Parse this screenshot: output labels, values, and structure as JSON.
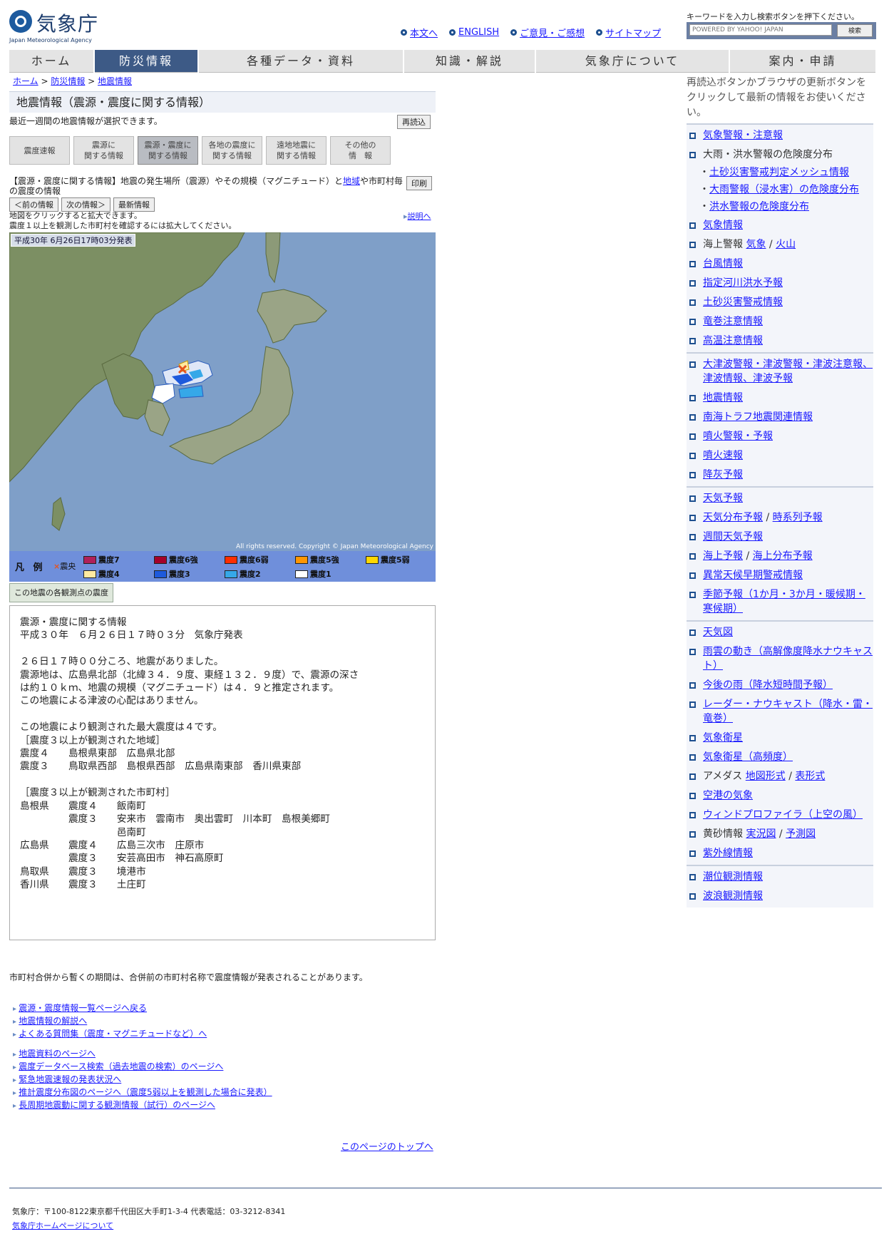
{
  "header": {
    "logo_text": "気象庁",
    "logo_sub": "Japan Meteorological Agency",
    "links": [
      "本文へ",
      "ENGLISH",
      "ご意見・ご感想",
      "サイトマップ"
    ],
    "search_hint": "キーワードを入力し検索ボタンを押下ください。",
    "search_placeholder": "POWERED BY YAHOO! JAPAN",
    "search_button": "検索"
  },
  "nav": [
    "ホーム",
    "防災情報",
    "各種データ・資料",
    "知識・解説",
    "気象庁について",
    "案内・申請"
  ],
  "breadcrumb": [
    "ホーム",
    "防災情報",
    "地震情報"
  ],
  "title": "地震情報（震源・震度に関する情報）",
  "subtitle": "最近一週間の地震情報が選択できます。",
  "reload": "再読込",
  "tabs": [
    [
      "震度速報",
      ""
    ],
    [
      "震源に",
      "関する情報"
    ],
    [
      "震源・震度に",
      "関する情報"
    ],
    [
      "各地の震度に",
      "関する情報"
    ],
    [
      "遠地地震に",
      "関する情報"
    ],
    [
      "その他の",
      "情　報"
    ]
  ],
  "desc_prefix": "【震源・震度に関する情報】地震の発生場所（震源）やその規模（マグニチュード）と",
  "desc_link": "地域",
  "desc_suffix": "や市町村毎の震度の情報",
  "print": "印刷",
  "nav_buttons": [
    "＜前の情報",
    "次の情報＞",
    "最新情報"
  ],
  "hint1": "地図をクリックすると拡大できます。",
  "hint2": "震度１以上を観測した市町村を確認するには拡大してください。",
  "explain": "説明へ",
  "map": {
    "published": "平成30年 6月26日17時03分発表",
    "copyright": "All rights reserved. Copyright © Japan Meteorological Agency",
    "legend_label": "凡 例",
    "epicenter": "震央",
    "legend_items": [
      {
        "label": "震度7",
        "color": "#b0205a"
      },
      {
        "label": "震度6強",
        "color": "#a5002a"
      },
      {
        "label": "震度6弱",
        "color": "#ff2d00"
      },
      {
        "label": "震度5強",
        "color": "#ff9600"
      },
      {
        "label": "震度5弱",
        "color": "#ffd800"
      },
      {
        "label": "震度4",
        "color": "#ffeaa0"
      },
      {
        "label": "震度3",
        "color": "#1e5adc"
      },
      {
        "label": "震度2",
        "color": "#36a8e8"
      },
      {
        "label": "震度1",
        "color": "#ffffff"
      }
    ]
  },
  "station_button": "この地震の各観測点の震度",
  "report": "震源・震度に関する情報\n平成３０年　６月２６日１７時０３分　気象庁発表\n\n２６日１７時００分ころ、地震がありました。\n震源地は、広島県北部（北緯３４．９度、東経１３２．９度）で、震源の深さ\nは約１０ｋｍ、地震の規模（マグニチュード）は４．９と推定されます。\nこの地震による津波の心配はありません。\n\nこの地震により観測された最大震度は４です。\n［震度３以上が観測された地域］\n震度４　　島根県東部　広島県北部\n震度３　　鳥取県西部　島根県西部　広島県南東部　香川県東部\n\n［震度３以上が観測された市町村］\n島根県　　震度４　　飯南町\n　　　　　震度３　　安来市　雲南市　奥出雲町　川本町　島根美郷町\n　　　　　　　　　　邑南町\n広島県　　震度４　　広島三次市　庄原市\n　　　　　震度３　　安芸高田市　神石高原町\n鳥取県　　震度３　　境港市\n香川県　　震度３　　土庄町",
  "merge_note": "市町村合併から暫くの期間は、合併前の市町村名称で震度情報が発表されることがあります。",
  "links1": [
    "震源・震度情報一覧ページへ戻る",
    "地震情報の解説へ",
    "よくある質問集（震度・マグニチュードなど）へ"
  ],
  "links2": [
    "地震資料のページへ",
    "震度データベース検索（過去地震の検索）のページへ",
    "緊急地震速報の発表状況へ",
    "推計震度分布図のページへ（震度5弱以上を観測した場合に発表）",
    "長周期地震動に関する観測情報（試行）のページへ"
  ],
  "page_top": "このページのトップへ",
  "footer_address": "気象庁：〒100-8122東京都千代田区大手町1-3-4 代表電話：03-3212-8341",
  "footer_link": "気象庁ホームページについて",
  "sidebar": {
    "intro": "再読込ボタンかブラウザの更新ボタンをクリックして最新の情報をお使いください。",
    "g1": {
      "i1": "気象警報・注意報",
      "i2": "大雨・洪水警報の危険度分布",
      "s1": "土砂災害警戒判定メッシュ情報",
      "s2": "大雨警報（浸水害）の危険度分布",
      "s3": "洪水警報の危険度分布",
      "i3": "気象情報",
      "i4_text": "海上警報",
      "i4_a": "気象",
      "i4_b": "火山",
      "i5": "台風情報",
      "i6": "指定河川洪水予報",
      "i7": "土砂災害警戒情報",
      "i8": "竜巻注意情報",
      "i9": "高温注意情報"
    },
    "g2": {
      "i1": "大津波警報・津波警報・津波注意報、津波情報、津波予報",
      "i2": "地震情報",
      "i3": "南海トラフ地震関連情報",
      "i4": "噴火警報・予報",
      "i5": "噴火速報",
      "i6": "降灰予報"
    },
    "g3": {
      "i1": "天気予報",
      "i2a": "天気分布予報",
      "i2b": "時系列予報",
      "i3": "週間天気予報",
      "i4a": "海上予報",
      "i4b": "海上分布予報",
      "i5": "異常天候早期警戒情報",
      "i6": "季節予報（1か月・3か月・暖候期・寒候期）"
    },
    "g4": {
      "i1": "天気図",
      "i2": "雨雲の動き（高解像度降水ナウキャスト）",
      "i3": "今後の雨（降水短時間予報）",
      "i4": "レーダー・ナウキャスト（降水・雷・竜巻）",
      "i5": "気象衛星",
      "i6": "気象衛星（高頻度）",
      "i7_text": "アメダス",
      "i7a": "地図形式",
      "i7b": "表形式",
      "i8": "空港の気象",
      "i9": "ウィンドプロファイラ（上空の風）",
      "i10_text": "黄砂情報",
      "i10a": "実況図",
      "i10b": "予測図",
      "i11": "紫外線情報"
    },
    "g5": {
      "i1": "潮位観測情報",
      "i2": "波浪観測情報"
    }
  }
}
